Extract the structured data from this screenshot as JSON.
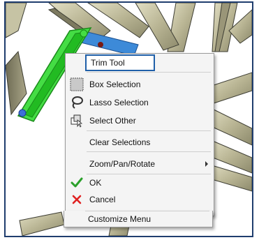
{
  "menu": {
    "items": [
      {
        "label": "Trim Tool",
        "icon": "none"
      },
      {
        "label": "Box Selection",
        "icon": "box-selection-icon"
      },
      {
        "label": "Lasso Selection",
        "icon": "lasso-icon"
      },
      {
        "label": "Select Other",
        "icon": "select-other-icon"
      },
      {
        "label": "Clear Selections",
        "icon": "none"
      },
      {
        "label": "Zoom/Pan/Rotate",
        "icon": "none",
        "submenu": true
      },
      {
        "label": "OK",
        "icon": "checkmark-icon"
      },
      {
        "label": "Cancel",
        "icon": "cancel-x-icon"
      },
      {
        "label": "Customize Menu",
        "icon": "none"
      }
    ]
  },
  "colors": {
    "frame_border": "#1f3d6e",
    "highlight_border": "#1f5fa8",
    "ok_green": "#2aa02a",
    "cancel_red": "#e02020",
    "selected_member": "#33dd33",
    "beam_fill": "#c9c6a8"
  }
}
